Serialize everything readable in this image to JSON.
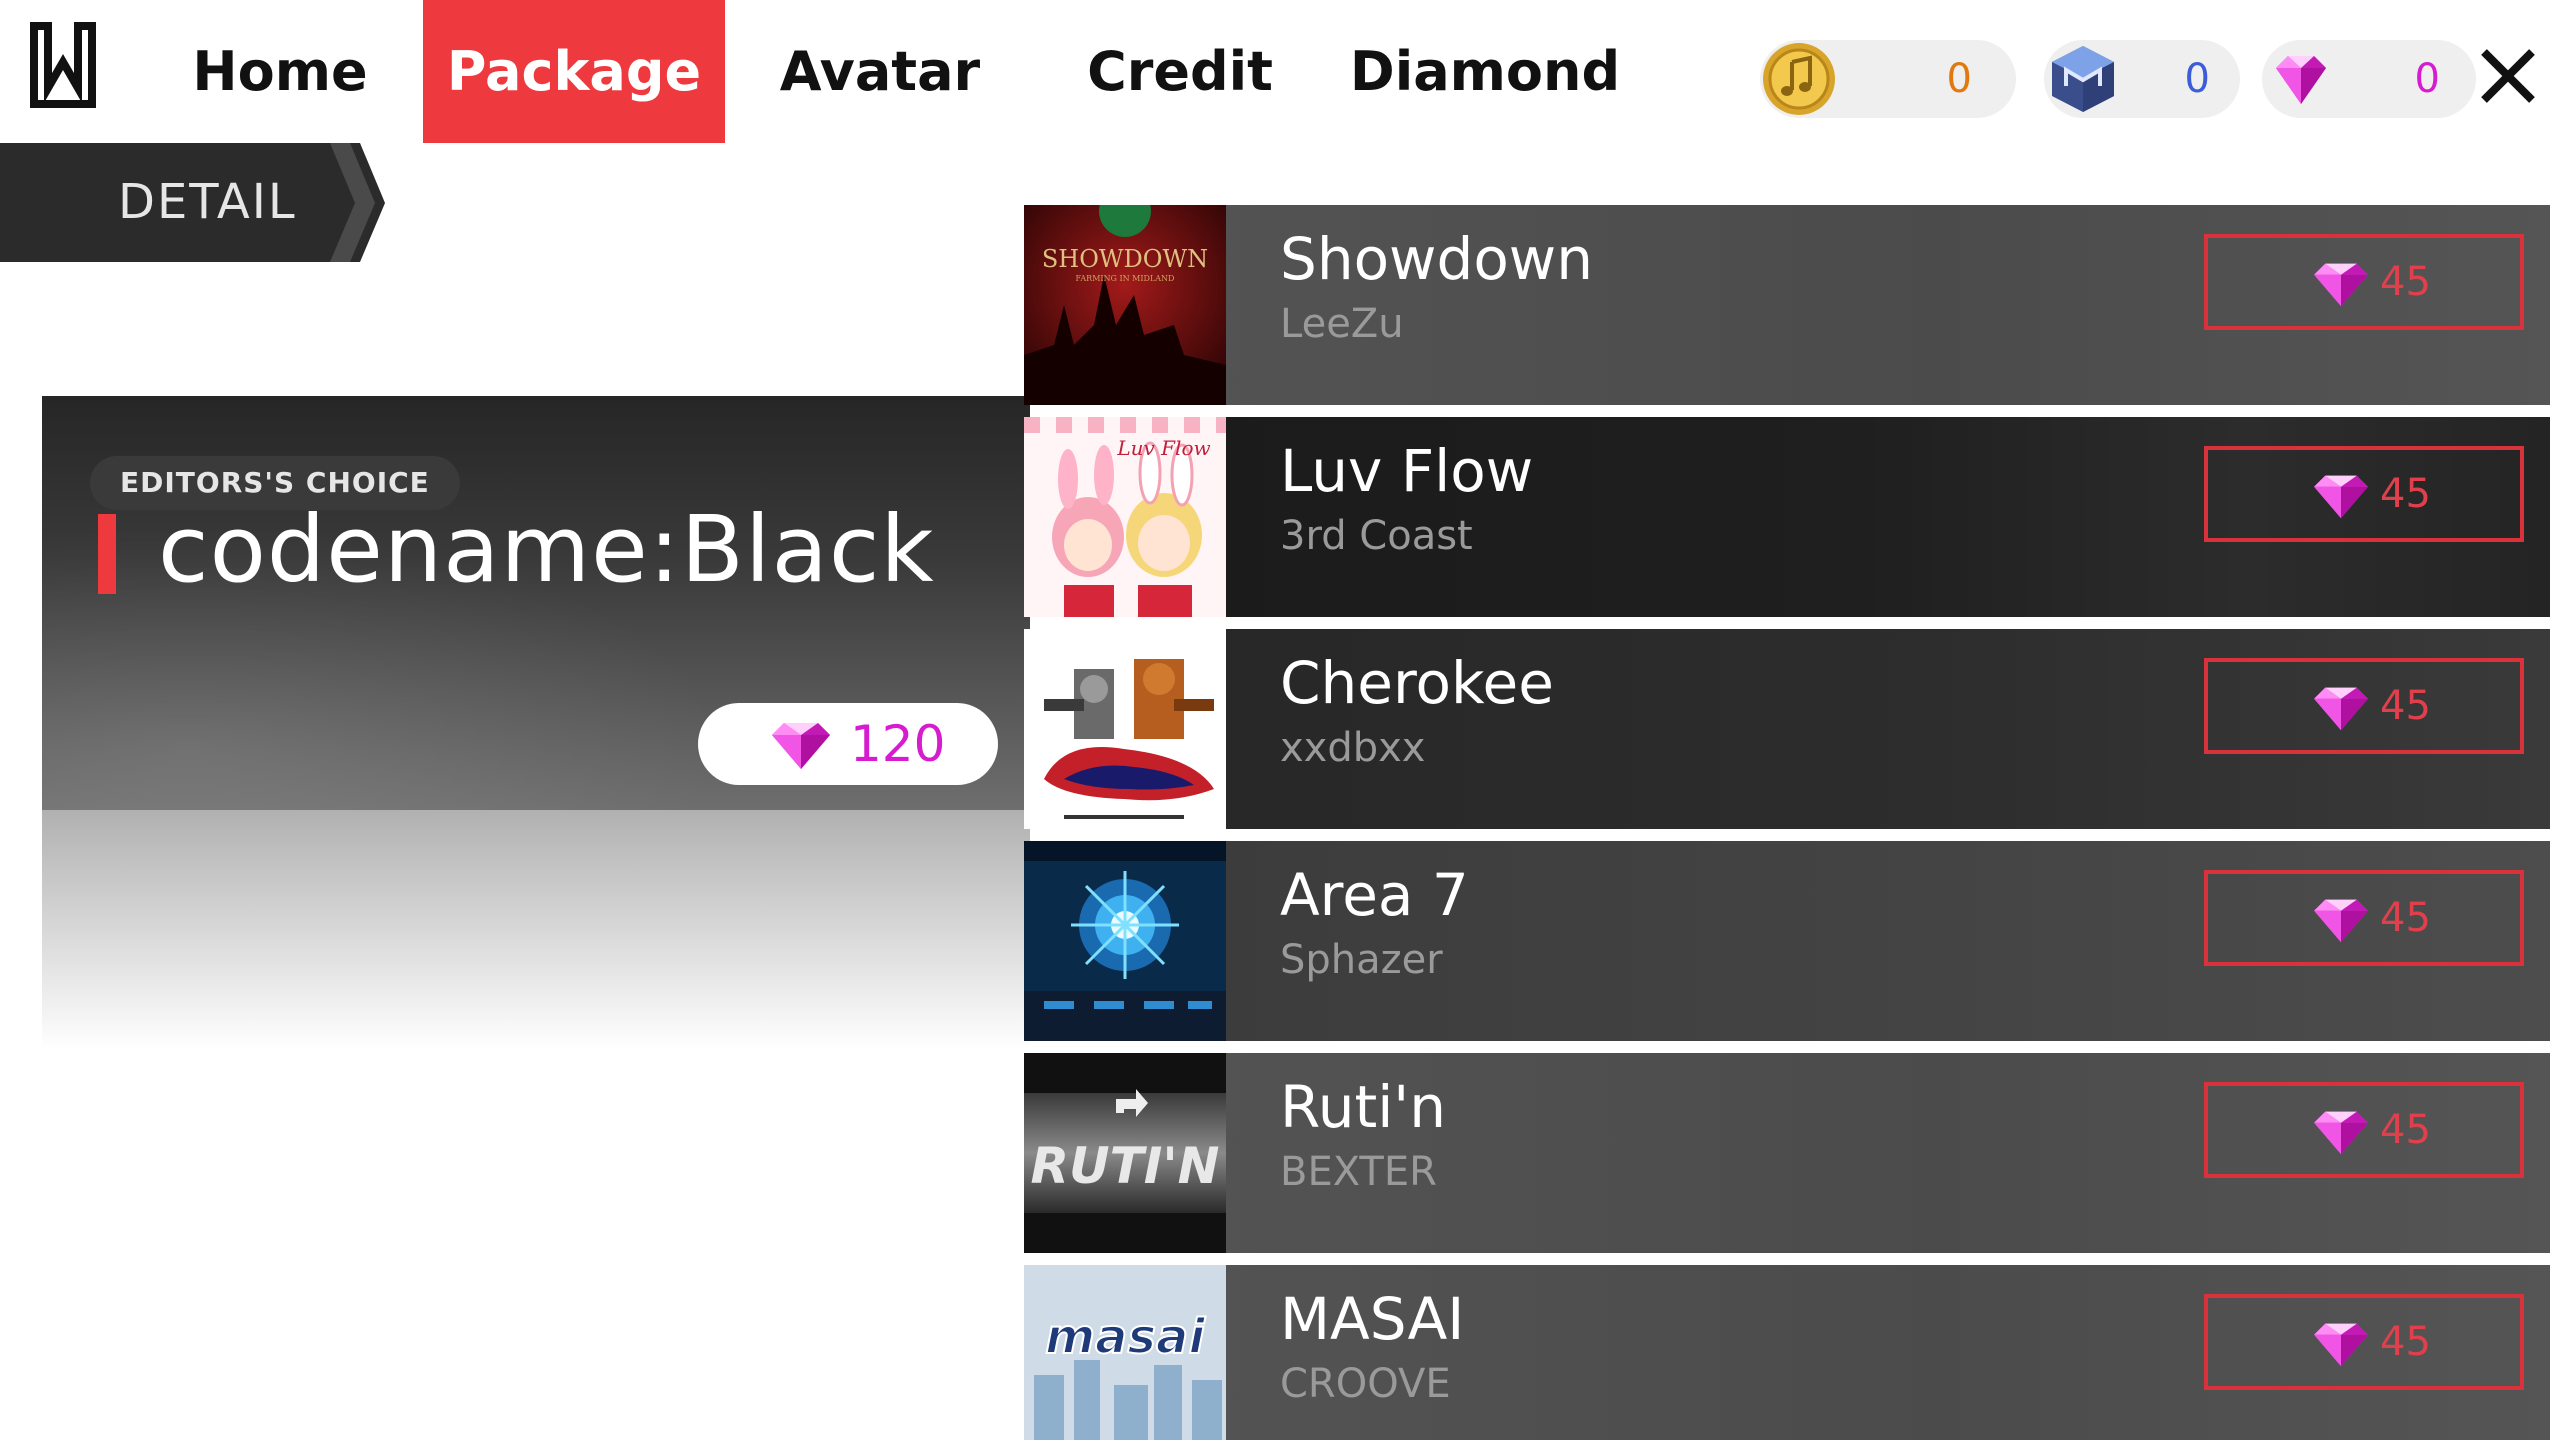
{
  "nav": {
    "tabs": [
      {
        "label": "Home"
      },
      {
        "label": "Package"
      },
      {
        "label": "Avatar"
      },
      {
        "label": "Credit"
      },
      {
        "label": "Diamond"
      }
    ],
    "active_tab": "Package"
  },
  "currencies": [
    {
      "icon": "music-coin-icon",
      "value": "0",
      "color": "#e07a10"
    },
    {
      "icon": "maxim-cube-icon",
      "value": "0",
      "color": "#3c5cd8"
    },
    {
      "icon": "diamond-icon",
      "value": "0",
      "color": "#d61bd0"
    }
  ],
  "detail_label": "DETAIL",
  "package": {
    "badge": "EDITORS'S CHOICE",
    "title": "codename:Black",
    "price": "120",
    "price_icon": "diamond-icon"
  },
  "songs": [
    {
      "title": "Showdown",
      "artist": "LeeZu",
      "price": "45",
      "thumb_text": "SHOWDOWN",
      "thumb_subtext": "FARMING IN MIDLAND"
    },
    {
      "title": "Luv Flow",
      "artist": "3rd Coast",
      "price": "45",
      "thumb_text": "Luv Flow"
    },
    {
      "title": "Cherokee",
      "artist": "xxdbxx",
      "price": "45",
      "thumb_text": ""
    },
    {
      "title": "Area 7",
      "artist": "Sphazer",
      "price": "45",
      "thumb_text": ""
    },
    {
      "title": "Ruti'n",
      "artist": "BEXTER",
      "price": "45",
      "thumb_text": "RUTI'N"
    },
    {
      "title": "MASAI",
      "artist": "CROOVE",
      "price": "45",
      "thumb_text": "masai"
    }
  ],
  "colors": {
    "accent_red": "#ee3a3e",
    "diamond_pink": "#d61bd0",
    "buy_border": "#d8323c"
  }
}
